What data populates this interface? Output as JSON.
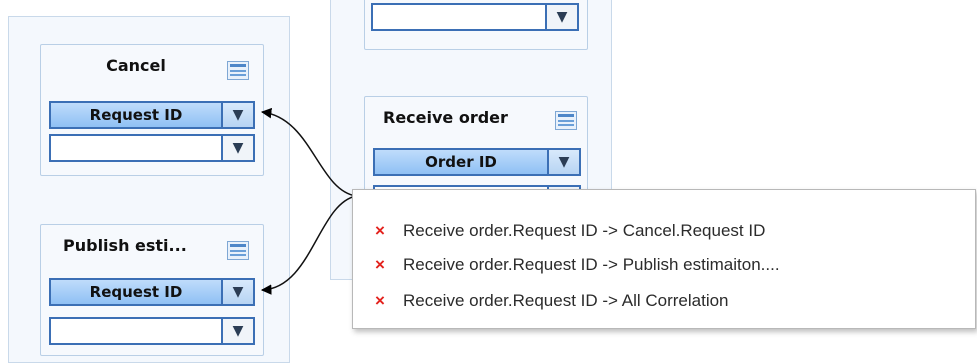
{
  "cards": {
    "cancel": {
      "title": "Cancel",
      "field1": "Request ID",
      "field2": ""
    },
    "publish": {
      "title": "Publish esti...",
      "field1": "Request ID",
      "field2": ""
    },
    "receive": {
      "title": "Receive order",
      "field1": "Order ID",
      "field2": ""
    },
    "top": {
      "field1": ""
    }
  },
  "context_menu": {
    "items": [
      {
        "icon": "delete-icon",
        "label": "Receive order.Request ID -> Cancel.Request ID"
      },
      {
        "icon": "delete-icon",
        "label": "Receive order.Request ID -> Publish estimaiton...."
      },
      {
        "icon": "delete-icon",
        "label": "Receive order.Request ID -> All Correlation"
      }
    ]
  },
  "glyphs": {
    "dropdown": "▼",
    "delete": "×"
  },
  "colors": {
    "field_fill": "#a6cdf7",
    "field_border": "#3b6fb5",
    "delete_x": "#e3211c"
  }
}
